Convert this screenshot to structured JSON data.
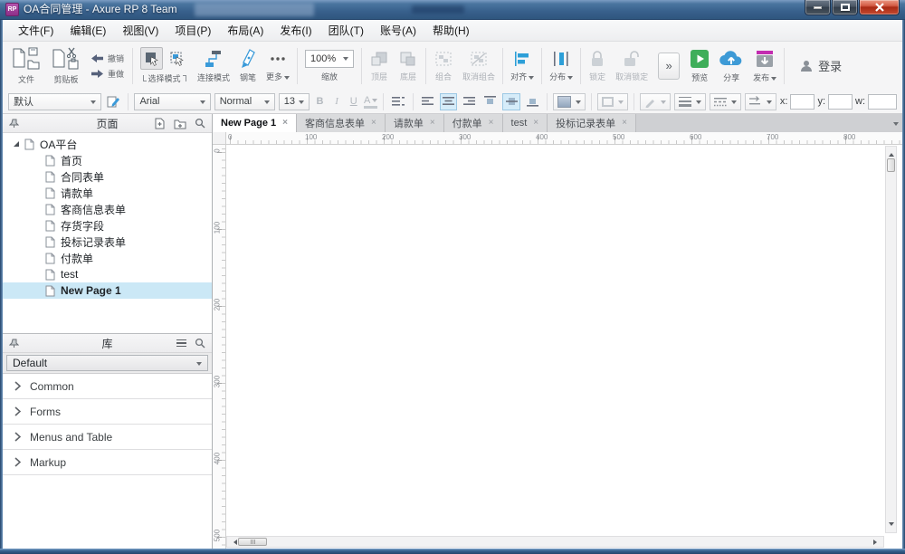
{
  "window": {
    "title": "OA合同管理 - Axure RP 8 Team",
    "badge": "RP"
  },
  "menu": {
    "items": [
      "文件(F)",
      "编辑(E)",
      "视图(V)",
      "项目(P)",
      "布局(A)",
      "发布(I)",
      "团队(T)",
      "账号(A)",
      "帮助(H)"
    ]
  },
  "toolbar": {
    "file": "文件",
    "clipboard": "剪贴板",
    "undo": "撤销",
    "redo": "重做",
    "select_mode": "选择模式",
    "connect_mode": "连接模式",
    "pen": "钢笔",
    "more": "更多",
    "zoom_value": "100%",
    "zoom": "缩放",
    "top_layer": "顶层",
    "bottom_layer": "底层",
    "group": "组合",
    "ungroup": "取消组合",
    "align": "对齐",
    "distribute": "分布",
    "lock": "锁定",
    "unlock": "取消锁定",
    "expand": "»",
    "preview": "预览",
    "share": "分享",
    "publish": "发布",
    "login": "登录"
  },
  "style_toolbar": {
    "preset": "默认",
    "font": "Arial",
    "weight": "Normal",
    "size": "13",
    "bold": "B",
    "italic": "I",
    "underline": "U",
    "color": "A",
    "x": "x:",
    "y": "y:",
    "w": "w:"
  },
  "pages_panel": {
    "title": "页面",
    "root_label": "OA平台",
    "items": [
      {
        "label": "首页"
      },
      {
        "label": "合同表单"
      },
      {
        "label": "请款单"
      },
      {
        "label": "客商信息表单"
      },
      {
        "label": "存货字段"
      },
      {
        "label": "投标记录表单"
      },
      {
        "label": "付款单"
      },
      {
        "label": "test"
      },
      {
        "label": "New Page 1",
        "selected": true
      }
    ]
  },
  "libraries_panel": {
    "title": "库",
    "library": "Default",
    "sections": [
      "Common",
      "Forms",
      "Menus and Table",
      "Markup"
    ]
  },
  "tabs": [
    {
      "label": "New Page 1",
      "active": true
    },
    {
      "label": "客商信息表单"
    },
    {
      "label": "请款单"
    },
    {
      "label": "付款单"
    },
    {
      "label": "test"
    },
    {
      "label": "投标记录表单"
    }
  ],
  "rulers": {
    "h": [
      "0",
      "100",
      "200",
      "300",
      "400",
      "500",
      "600",
      "700",
      "800"
    ],
    "v": [
      "0",
      "100",
      "200",
      "300",
      "400",
      "500"
    ]
  }
}
